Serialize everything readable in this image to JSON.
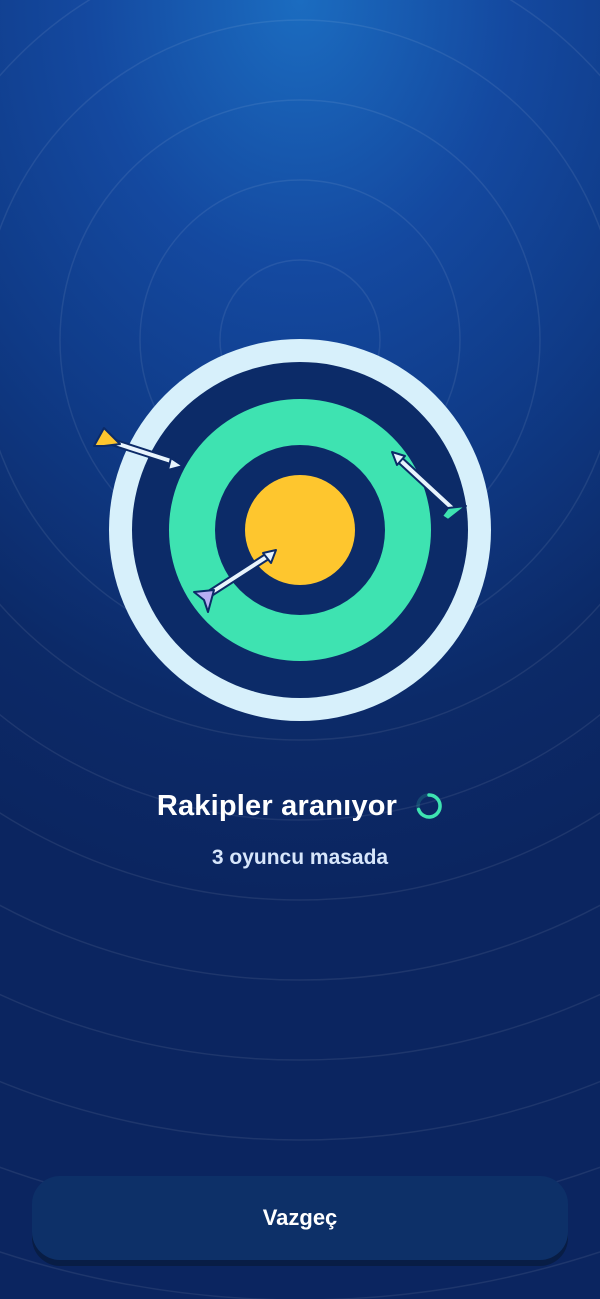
{
  "status": {
    "title": "Rakipler aranıyor",
    "subtitle": "3 oyuncu masada"
  },
  "actions": {
    "cancel_label": "Vazgeç"
  },
  "colors": {
    "ring_outer": "#d7f0fb",
    "ring_navy": "#0c2b68",
    "ring_green": "#3ee3b1",
    "bullseye": "#fec62e",
    "accent": "#3ee3b1"
  },
  "icons": {
    "loading": "spinner-icon",
    "target": "target-icon",
    "arrows": [
      "arrow-yellow-icon",
      "arrow-green-icon",
      "arrow-purple-icon"
    ]
  }
}
